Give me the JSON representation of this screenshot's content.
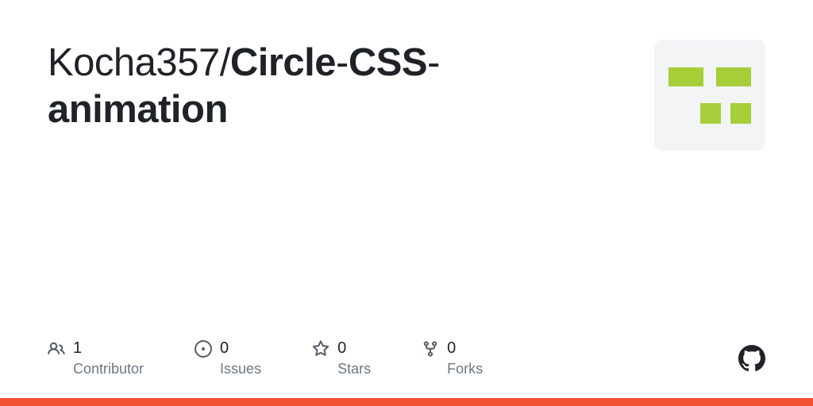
{
  "repo": {
    "owner": "Kocha357",
    "name_part1": "Circle",
    "name_part2": "CSS",
    "name_part3": "animation"
  },
  "avatar": {
    "color": "#a6ce39",
    "background": "#f3f4f6"
  },
  "stats": [
    {
      "icon": "people",
      "count": "1",
      "label": "Contributor"
    },
    {
      "icon": "issue",
      "count": "0",
      "label": "Issues"
    },
    {
      "icon": "star",
      "count": "0",
      "label": "Stars"
    },
    {
      "icon": "fork",
      "count": "0",
      "label": "Forks"
    }
  ],
  "accent_color": "#f05133"
}
